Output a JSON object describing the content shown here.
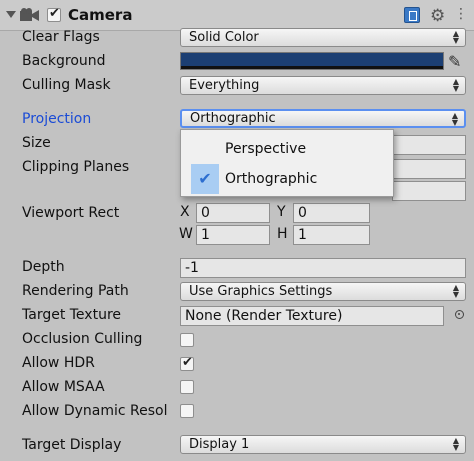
{
  "header": {
    "title": "Camera",
    "enabled": true
  },
  "rows": {
    "clear_flags": {
      "label": "Clear Flags",
      "value": "Solid Color"
    },
    "background": {
      "label": "Background",
      "color": "#1c3f73"
    },
    "culling_mask": {
      "label": "Culling Mask",
      "value": "Everything"
    },
    "projection": {
      "label": "Projection",
      "value": "Orthographic"
    },
    "size": {
      "label": "Size"
    },
    "clipping": {
      "label": "Clipping Planes"
    },
    "viewport": {
      "label": "Viewport Rect",
      "x_label": "X",
      "x": "0",
      "y_label": "Y",
      "y": "0",
      "w_label": "W",
      "w": "1",
      "h_label": "H",
      "h": "1"
    },
    "depth": {
      "label": "Depth",
      "value": "-1"
    },
    "rendering_path": {
      "label": "Rendering Path",
      "value": "Use Graphics Settings"
    },
    "target_texture": {
      "label": "Target Texture",
      "value": "None (Render Texture)"
    },
    "occlusion": {
      "label": "Occlusion Culling",
      "checked": false
    },
    "allow_hdr": {
      "label": "Allow HDR",
      "checked": true
    },
    "allow_msaa": {
      "label": "Allow MSAA",
      "checked": false
    },
    "dynamic_res": {
      "label": "Allow Dynamic Resol",
      "checked": false
    },
    "target_display": {
      "label": "Target Display",
      "value": "Display 1"
    }
  },
  "popup": {
    "options": [
      {
        "label": "Perspective",
        "selected": false
      },
      {
        "label": "Orthographic",
        "selected": true
      }
    ]
  }
}
